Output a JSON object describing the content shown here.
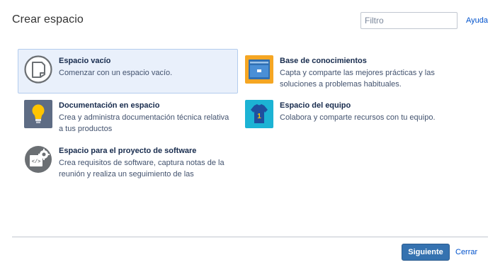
{
  "dialog": {
    "title": "Crear espacio",
    "filter_placeholder": "Filtro",
    "help_label": "Ayuda"
  },
  "options": [
    {
      "name": "Espacio vacío",
      "description": "Comenzar con un espacio vacío.",
      "icon": "blank-page-icon",
      "selected": true
    },
    {
      "name": "Base de conocimientos",
      "description": "Capta y comparte las mejores prácticas y las soluciones a problemas habituales.",
      "icon": "knowledge-base-icon",
      "selected": false
    },
    {
      "name": "Documentación en espacio",
      "description": "Crea y administra documentación técnica relativa a tus productos",
      "icon": "lightbulb-icon",
      "selected": false
    },
    {
      "name": "Espacio del equipo",
      "description": "Colabora y comparte recursos con tu equipo.",
      "icon": "team-jersey-icon",
      "selected": false
    },
    {
      "name": "Espacio para el proyecto de software",
      "description": "Crea requisitos de software, captura notas de la reunión y realiza un seguimiento de las",
      "icon": "software-gear-icon",
      "selected": false
    }
  ],
  "footer": {
    "next_label": "Siguiente",
    "close_label": "Cerrar"
  },
  "colors": {
    "primary_button": "#3572b0",
    "link": "#0052cc",
    "selected_bg": "#e9f0fb",
    "kb_icon_bg": "#f5a623",
    "doc_icon_bg": "#5e6c84",
    "team_icon_bg": "#1cb3d4"
  }
}
